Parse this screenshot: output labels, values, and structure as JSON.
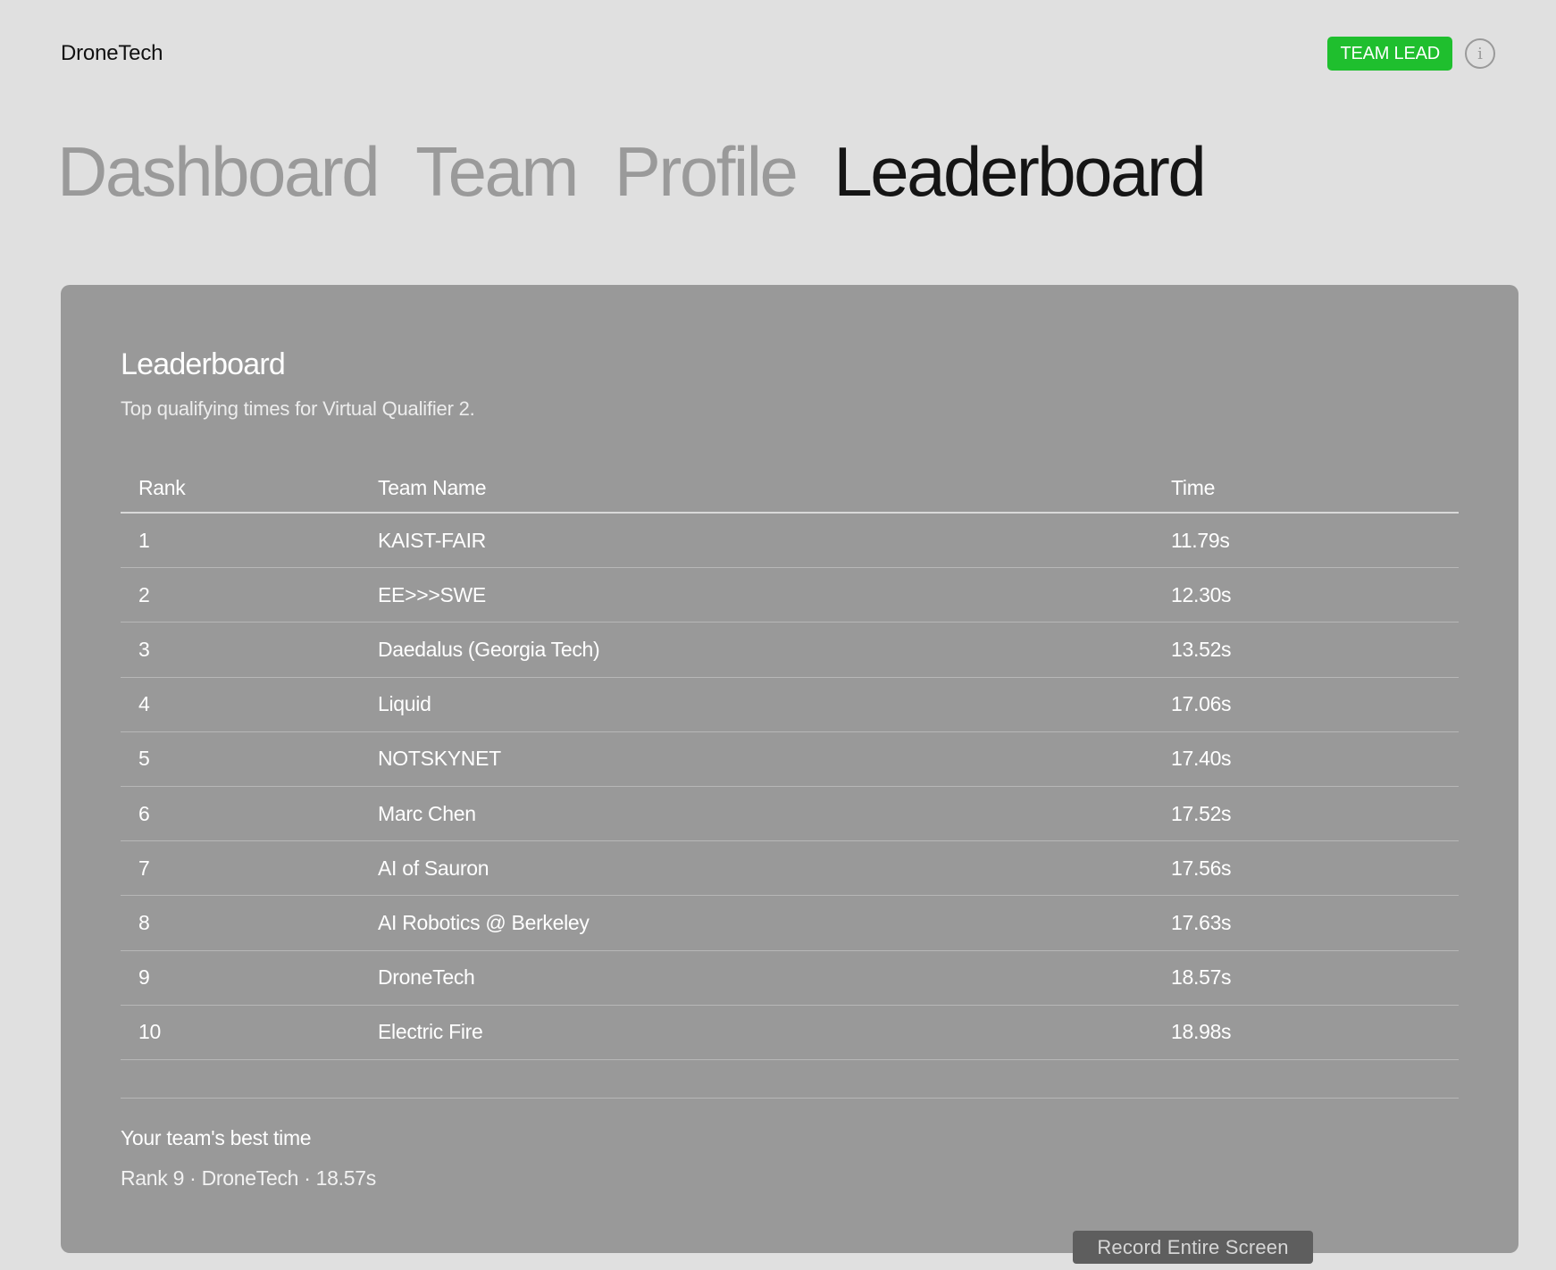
{
  "header": {
    "brand": "DroneTech",
    "role_badge": "TEAM LEAD",
    "info_glyph": "i"
  },
  "colors": {
    "background": "#e0e0e0",
    "card": "#999999",
    "badge": "#1fbf2e",
    "nav_inactive": "#9a9a9a",
    "nav_active": "#151515"
  },
  "nav": {
    "items": [
      {
        "label": "Dashboard",
        "active": false
      },
      {
        "label": "Team",
        "active": false
      },
      {
        "label": "Profile",
        "active": false
      },
      {
        "label": "Leaderboard",
        "active": true
      }
    ]
  },
  "leaderboard": {
    "title": "Leaderboard",
    "subtitle": "Top qualifying times for Virtual Qualifier 2.",
    "columns": [
      "Rank",
      "Team Name",
      "Time"
    ],
    "rows": [
      {
        "rank": "1",
        "team": "KAIST-FAIR",
        "time": "11.79s"
      },
      {
        "rank": "2",
        "team": "EE>>>SWE",
        "time": "12.30s"
      },
      {
        "rank": "3",
        "team": "Daedalus (Georgia Tech)",
        "time": "13.52s"
      },
      {
        "rank": "4",
        "team": "Liquid",
        "time": "17.06s"
      },
      {
        "rank": "5",
        "team": "NOTSKYNET",
        "time": "17.40s"
      },
      {
        "rank": "6",
        "team": "Marc Chen",
        "time": "17.52s"
      },
      {
        "rank": "7",
        "team": "AI of Sauron",
        "time": "17.56s"
      },
      {
        "rank": "8",
        "team": "AI Robotics @ Berkeley",
        "time": "17.63s"
      },
      {
        "rank": "9",
        "team": "DroneTech",
        "time": "18.57s"
      },
      {
        "rank": "10",
        "team": "Electric Fire",
        "time": "18.98s"
      }
    ],
    "best_label": "Your team's best time",
    "best_value": "Rank 9 · DroneTech · 18.57s"
  },
  "overlay": {
    "record_label": "Record Entire Screen"
  }
}
